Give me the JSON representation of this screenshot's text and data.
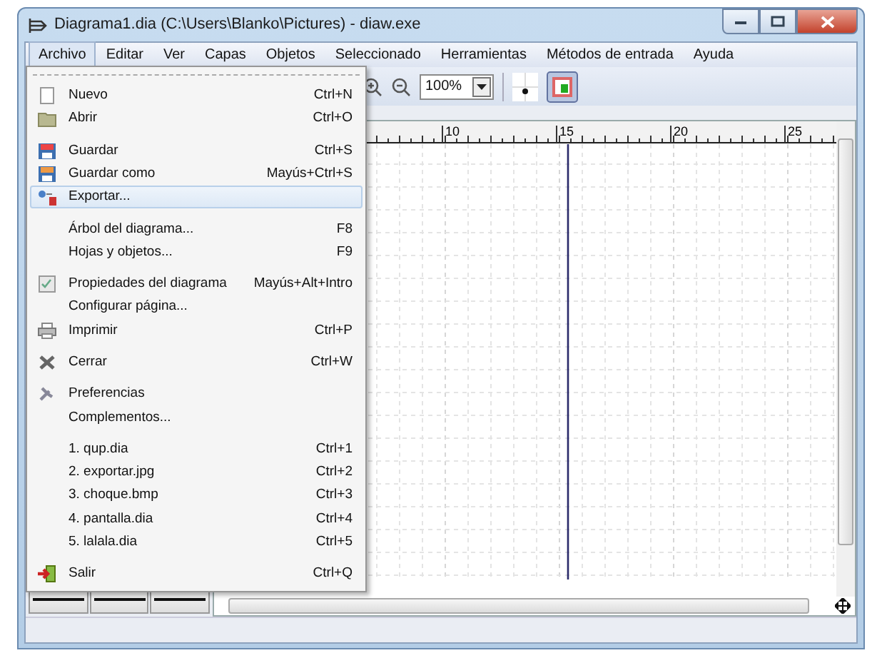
{
  "window": {
    "title": "Diagrama1.dia (C:\\Users\\Blanko\\Pictures) - diaw.exe"
  },
  "menubar": [
    {
      "label": "Archivo",
      "selected": true
    },
    {
      "label": "Editar",
      "selected": false
    },
    {
      "label": "Ver",
      "selected": false
    },
    {
      "label": "Capas",
      "selected": false
    },
    {
      "label": "Objetos",
      "selected": false
    },
    {
      "label": "Seleccionado",
      "selected": false
    },
    {
      "label": "Herramientas",
      "selected": false
    },
    {
      "label": "Métodos de entrada",
      "selected": false
    },
    {
      "label": "Ayuda",
      "selected": false
    }
  ],
  "toolbar": {
    "zoom": "100%"
  },
  "file_menu": [
    {
      "kind": "item",
      "label": "Nuevo",
      "shortcut": "Ctrl+N",
      "selected": false
    },
    {
      "kind": "item",
      "label": "Abrir",
      "shortcut": "Ctrl+O",
      "selected": false
    },
    {
      "kind": "separator"
    },
    {
      "kind": "item",
      "label": "Guardar",
      "shortcut": "Ctrl+S",
      "selected": false
    },
    {
      "kind": "item",
      "label": "Guardar como",
      "shortcut": "Mayús+Ctrl+S",
      "selected": false
    },
    {
      "kind": "item",
      "label": "Exportar...",
      "selected": true
    },
    {
      "kind": "separator"
    },
    {
      "kind": "item",
      "label": "Árbol del diagrama...",
      "shortcut": "F8",
      "selected": false
    },
    {
      "kind": "item",
      "label": "Hojas y objetos...",
      "shortcut": "F9",
      "selected": false
    },
    {
      "kind": "separator"
    },
    {
      "kind": "item",
      "label": "Propiedades del diagrama",
      "shortcut": "Mayús+Alt+Intro",
      "selected": false
    },
    {
      "kind": "item",
      "label": "Configurar página...",
      "selected": false
    },
    {
      "kind": "item",
      "label": "Imprimir",
      "shortcut": "Ctrl+P",
      "selected": false
    },
    {
      "kind": "separator"
    },
    {
      "kind": "item",
      "label": "Cerrar",
      "shortcut": "Ctrl+W",
      "selected": false
    },
    {
      "kind": "separator"
    },
    {
      "kind": "item",
      "label": "Preferencias",
      "selected": false
    },
    {
      "kind": "item",
      "label": "Complementos...",
      "selected": false
    },
    {
      "kind": "separator"
    },
    {
      "kind": "item",
      "label": "1. qup.dia",
      "shortcut": "Ctrl+1",
      "selected": false
    },
    {
      "kind": "item",
      "label": "2. exportar.jpg",
      "shortcut": "Ctrl+2",
      "selected": false
    },
    {
      "kind": "item",
      "label": "3. choque.bmp",
      "shortcut": "Ctrl+3",
      "selected": false
    },
    {
      "kind": "item",
      "label": "4. pantalla.dia",
      "shortcut": "Ctrl+4",
      "selected": false
    },
    {
      "kind": "item",
      "label": "5. lalala.dia",
      "shortcut": "Ctrl+5",
      "selected": false
    },
    {
      "kind": "separator"
    },
    {
      "kind": "item",
      "label": "Salir",
      "shortcut": "Ctrl+Q",
      "selected": false
    }
  ],
  "ruler": {
    "labels": [
      "10",
      "15",
      "20",
      "25"
    ]
  }
}
